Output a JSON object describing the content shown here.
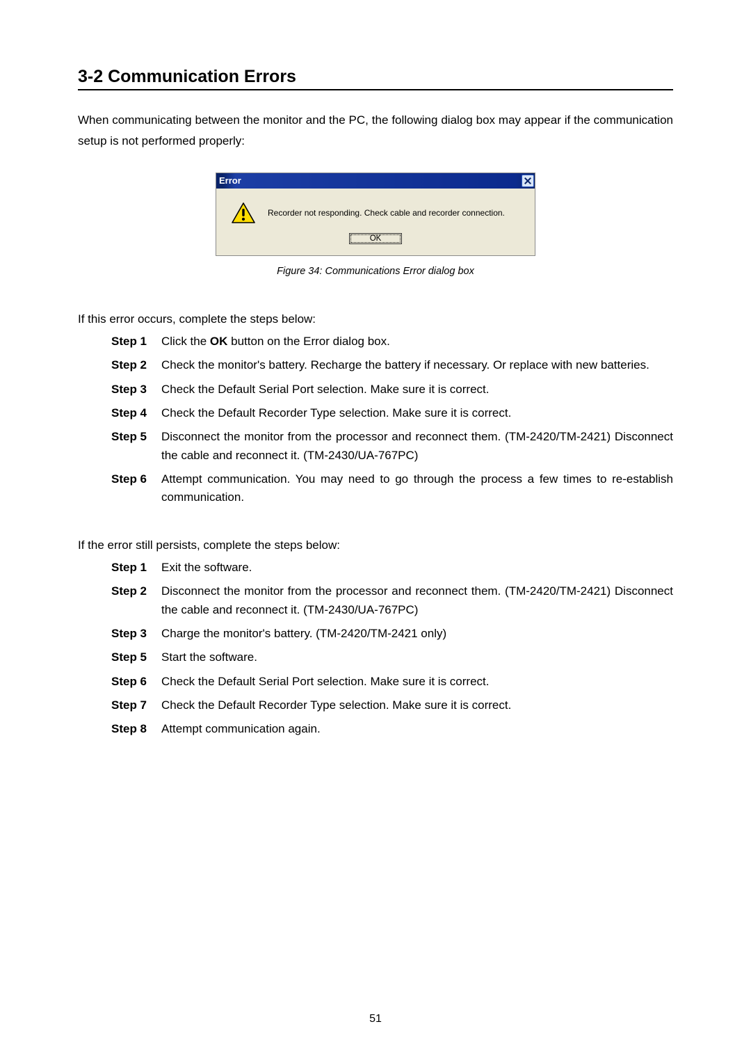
{
  "heading": "3-2 Communication Errors",
  "intro": "When communicating between the monitor and the PC, the following dialog box may appear if the communication setup is not performed properly:",
  "dialog": {
    "title": "Error",
    "message": "Recorder not responding.  Check cable and recorder connection.",
    "ok_label": "OK",
    "icon_name": "warning-icon",
    "close_name": "close-icon"
  },
  "caption": "Figure 34: Communications Error dialog box",
  "section1_intro": "If this error occurs, complete the steps below:",
  "steps1": [
    {
      "label": "Step 1",
      "html": "Click the <b>OK</b> button on the Error dialog box."
    },
    {
      "label": "Step 2",
      "html": "Check the monitor's battery.  Recharge the battery if necessary. Or replace with new batteries."
    },
    {
      "label": "Step 3",
      "html": "Check the Default Serial Port selection.  Make sure it is correct."
    },
    {
      "label": "Step 4",
      "html": "Check the Default Recorder Type selection. Make sure it is correct."
    },
    {
      "label": "Step 5",
      "html": "Disconnect the monitor from the processor and reconnect them. (TM-2420/TM-2421) Disconnect the cable and reconnect it. (TM-2430/UA-767PC)"
    },
    {
      "label": "Step 6",
      "html": "Attempt communication. You may need to go through the process a few times to re-establish communication."
    }
  ],
  "section2_intro": "If the error still persists, complete the steps below:",
  "steps2": [
    {
      "label": "Step 1",
      "html": "Exit the software."
    },
    {
      "label": "Step 2",
      "html": "Disconnect the monitor from the processor and reconnect them. (TM-2420/TM-2421) Disconnect the cable and reconnect it. (TM-2430/UA-767PC)"
    },
    {
      "label": "Step 3",
      "html": "Charge the monitor's battery. (TM-2420/TM-2421 only)"
    },
    {
      "label": "Step 5",
      "html": "Start the software."
    },
    {
      "label": "Step 6",
      "html": "Check the Default Serial Port selection.  Make sure it is correct."
    },
    {
      "label": "Step 7",
      "html": "Check the Default Recorder Type selection. Make sure it is correct."
    },
    {
      "label": "Step 8",
      "html": "Attempt communication again."
    }
  ],
  "page_number": "51"
}
